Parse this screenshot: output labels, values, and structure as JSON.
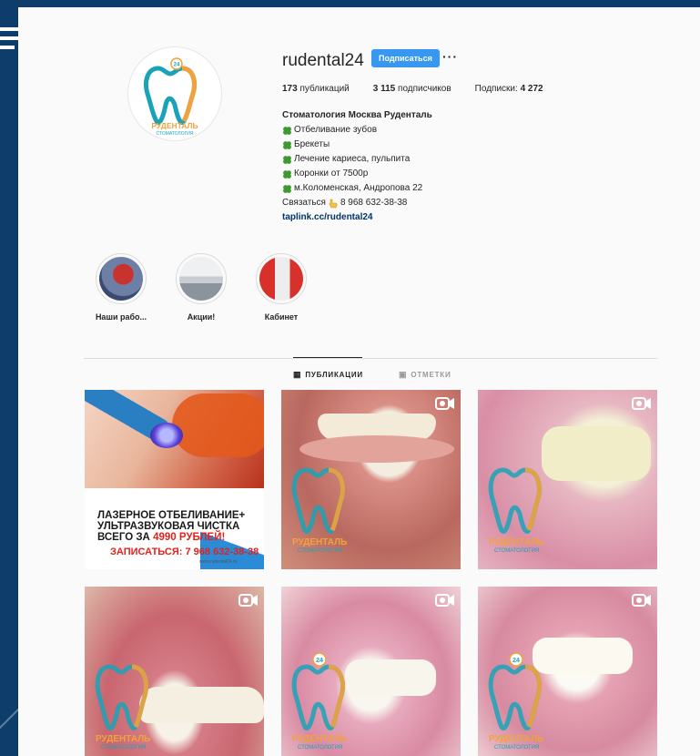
{
  "profile": {
    "username": "rudental24",
    "follow_label": "Подписаться",
    "more_label": "···",
    "logo_text_1": "РУДЕНТАЛЬ",
    "logo_text_2": "СТОМАТОЛОГИЯ",
    "logo_badge": "24"
  },
  "stats": {
    "posts_num": "173",
    "posts_label": "публикаций",
    "followers_num": "3 115",
    "followers_label": "подписчиков",
    "following_label": "Подписки:",
    "following_num": "4 272"
  },
  "bio": {
    "name": "Стоматология Москва Руденталь",
    "lines": [
      "Отбеливание зубов",
      "Брекеты",
      "Лечение кариеса, пульпита",
      "Коронки от 7500р",
      " м.Коломенская, Андропова 22"
    ],
    "contact_prefix": "Связаться",
    "phone": "8 968 632-38-38",
    "link": "taplink.cc/rudental24"
  },
  "highlights": [
    {
      "label": "Наши рабо..."
    },
    {
      "label": "Акции!"
    },
    {
      "label": "Кабинет"
    }
  ],
  "tabs": {
    "posts": "ПУБЛИКАЦИИ",
    "tagged": "ОТМЕТКИ"
  },
  "promo": {
    "line1": "ЛАЗЕРНОЕ ОТБЕЛИВАНИЕ+",
    "line2": "УЛЬТРАЗВУКОВАЯ ЧИСТКА",
    "line3_prefix": "ВСЕГО ЗА ",
    "line3_price": "4990 РУБЛЕЙ!",
    "cta": "ЗАПИСАТЬСЯ: 7 968 632-38-38",
    "site": "www.rudental24.ru"
  },
  "colors": {
    "accent": "#3897f0",
    "background": "#fafafa",
    "frame": "#0e3d6b",
    "brand_orange": "#f2a23a",
    "brand_teal": "#1aa3b8"
  }
}
